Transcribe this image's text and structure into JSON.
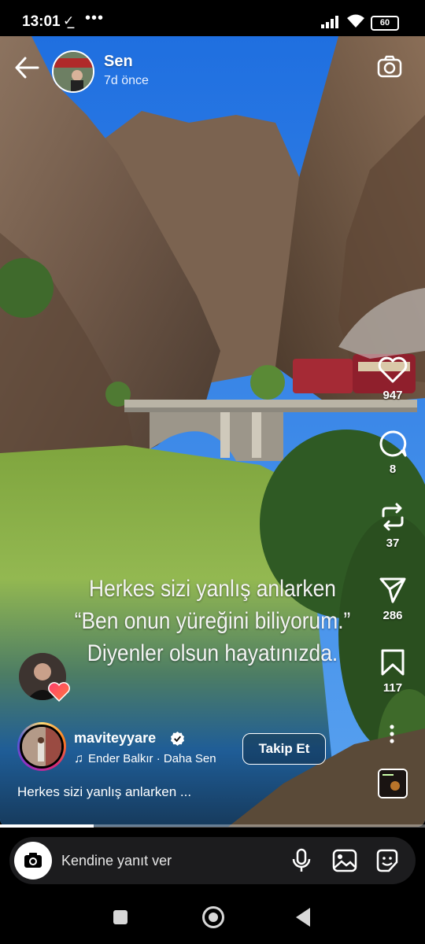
{
  "status_bar": {
    "time": "13:01",
    "download_glyph": "✓̲",
    "more": "•••",
    "battery": "60",
    "icons": [
      "signal-icon",
      "wifi-icon",
      "battery-icon"
    ]
  },
  "story_header": {
    "username": "Sen",
    "time_ago": "7d önce",
    "avatar_sign": "SEDAT PEKER"
  },
  "story": {
    "progress": 0.22,
    "quote_lines": [
      "Herkes sizi yanlış anlarken",
      "“Ben onun yüreğini biliyorum.”",
      "Diyenler olsun hayatınızda."
    ]
  },
  "actions": {
    "like_count": "947",
    "comment_count": "8",
    "repost_count": "37",
    "share_count": "286",
    "save_count": "117"
  },
  "post_info": {
    "account": "maviteyyare",
    "music": "Ender Balkır · Daha Sen",
    "follow_label": "Takip Et",
    "caption": "Herkes sizi yanlış anlarken ..."
  },
  "reply_bar": {
    "placeholder": "Kendine yanıt ver"
  },
  "colors": {
    "sky": "#2f7fe6",
    "water": "#8db04c",
    "follow_border": "#ffffff",
    "reply_bg": "#1c1c1e"
  }
}
